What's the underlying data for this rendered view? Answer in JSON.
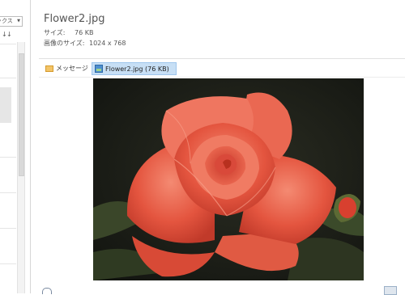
{
  "left_pane": {
    "sort_label": "ックス",
    "sort_icon_1": "↓",
    "sort_icon_2": "↓"
  },
  "preview": {
    "title": "Flower2.jpg",
    "size_label": "サイズ:",
    "size_value": "76 KB",
    "dimensions_label": "画像のサイズ:",
    "dimensions_value": "1024 x 768"
  },
  "attachments": {
    "message_tab": "メッセージ",
    "attachment_chip": "Flower2.jpg (76 KB)"
  },
  "image": {
    "subject": "red rose",
    "colors": {
      "petal": "#e2513f",
      "petal_light": "#f27a64",
      "leaf": "#3d4a2c",
      "background": "#1c1e17"
    }
  },
  "icons": {
    "message": "envelope-icon",
    "attachment": "image-file-icon"
  }
}
